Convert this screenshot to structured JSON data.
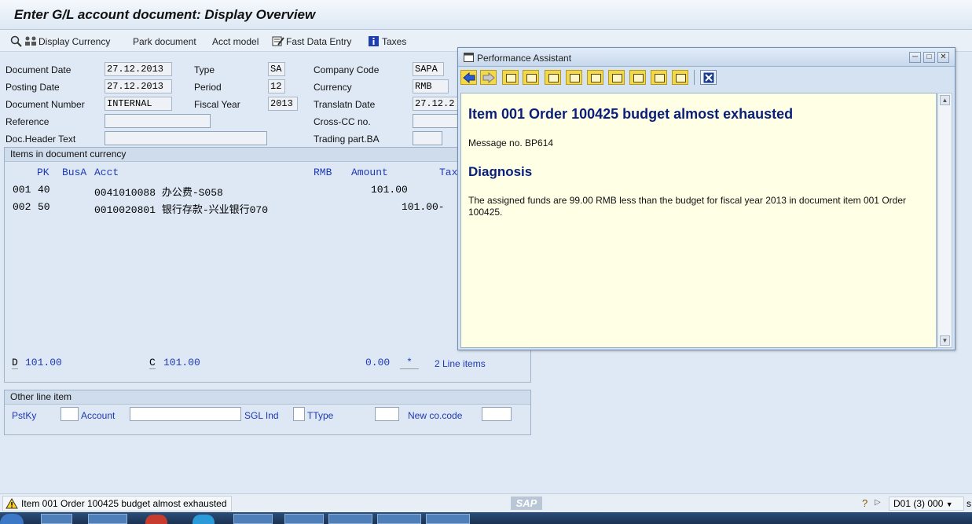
{
  "window": {
    "title": "Enter G/L account document: Display Overview"
  },
  "toolbar": {
    "display_currency": "Display Currency",
    "park_document": "Park document",
    "acct_model": "Acct model",
    "fast_data_entry": "Fast Data Entry",
    "taxes": "Taxes"
  },
  "header": {
    "document_date": {
      "label": "Document Date",
      "value": "27.12.2013"
    },
    "posting_date": {
      "label": "Posting Date",
      "value": "27.12.2013"
    },
    "document_number": {
      "label": "Document Number",
      "value": "INTERNAL"
    },
    "reference": {
      "label": "Reference",
      "value": ""
    },
    "doc_header_text": {
      "label": "Doc.Header Text",
      "value": ""
    },
    "type": {
      "label": "Type",
      "value": "SA"
    },
    "period": {
      "label": "Period",
      "value": "12"
    },
    "fiscal_year": {
      "label": "Fiscal Year",
      "value": "2013"
    },
    "company_code": {
      "label": "Company Code",
      "value": "SAPA"
    },
    "currency": {
      "label": "Currency",
      "value": "RMB"
    },
    "translation_date": {
      "label": "Translatn Date",
      "value": "27.12.2"
    },
    "cross_cc": {
      "label": "Cross-CC no.",
      "value": ""
    },
    "trading_part": {
      "label": "Trading part.BA",
      "value": ""
    }
  },
  "items": {
    "title": "Items in document currency",
    "columns": {
      "pk": "PK",
      "busa": "BusA",
      "acct": "Acct",
      "rmb": "RMB",
      "amount": "Amount",
      "tax": "Tax"
    },
    "rows": [
      {
        "no": "001",
        "pk": "40",
        "account": "0041010088 办公费-S058",
        "amount": "101.00"
      },
      {
        "no": "002",
        "pk": "50",
        "account": "0010020801 银行存款-兴业银行070",
        "amount": "101.00-"
      }
    ],
    "totals": {
      "debit_label": "D",
      "debit": "101.00",
      "credit_label": "C",
      "credit": "101.00",
      "balance": "0.00",
      "star": "*",
      "line_items": "2 Line items"
    }
  },
  "other_line": {
    "title": "Other line item",
    "pstky_label": "PstKy",
    "account_label": "Account",
    "sgl_label": "SGL Ind",
    "ttype_label": "TType",
    "new_cocode_label": "New co.code"
  },
  "status": {
    "message": "Item 001 Order 100425 budget almost exhausted",
    "system": "D01 (3) 000",
    "tail": "s"
  },
  "popup": {
    "title": "Performance Assistant",
    "heading": "Item 001 Order 100425 budget almost exhausted",
    "message_no": "Message no. BP614",
    "diagnosis_heading": "Diagnosis",
    "diagnosis_text": "The assigned funds are 99.00 RMB less than the budget  for fiscal year 2013 in document item 001 Order 100425."
  },
  "colors": {
    "popup_heading": "#0a1f7a",
    "content_bg": "#ffffe6",
    "link_blue": "#1f39b5"
  }
}
